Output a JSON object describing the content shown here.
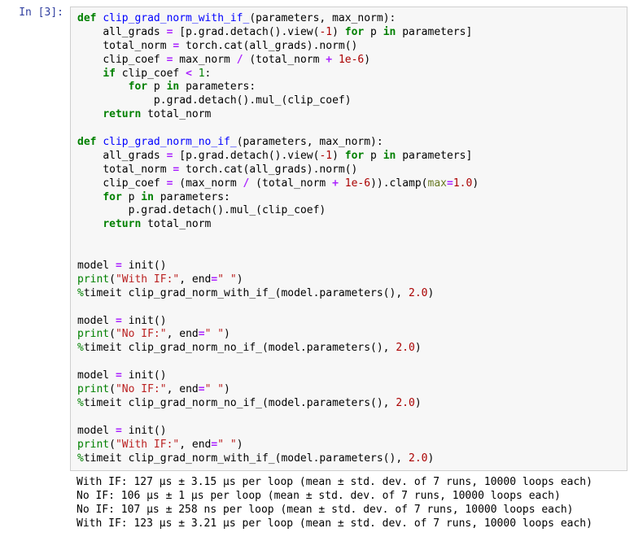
{
  "prompt": "In [3]:",
  "code": {
    "l1": {
      "def": "def",
      "fname": "clip_grad_norm_with_if_",
      "sig": "(parameters, max_norm):"
    },
    "l2": {
      "indent": "    ",
      "lhs": "all_grads ",
      "eq": "=",
      "mid": " [p.grad.detach().view(",
      "neg1": "-1",
      "after1": ") ",
      "for": "for",
      "mid2": " p ",
      "in": "in",
      "tail": " parameters]"
    },
    "l3": {
      "indent": "    ",
      "lhs": "total_norm ",
      "eq": "=",
      "tail": " torch.cat(all_grads).norm()"
    },
    "l4": {
      "indent": "    ",
      "lhs": "clip_coef ",
      "eq": "=",
      "mid": " max_norm ",
      "div": "/",
      "mid2": " (total_norm ",
      "plus": "+",
      "sp": " ",
      "eps": "1e-6",
      "close": ")"
    },
    "l5": {
      "indent": "    ",
      "if": "if",
      "mid": " clip_coef ",
      "lt": "<",
      "sp": " ",
      "one": "1",
      "colon": ":"
    },
    "l6": {
      "indent": "        ",
      "for": "for",
      "mid": " p ",
      "in": "in",
      "tail": " parameters:"
    },
    "l7": {
      "indent": "            ",
      "body": "p.grad.detach().mul_(clip_coef)"
    },
    "l8": {
      "indent": "    ",
      "ret": "return",
      "tail": " total_norm"
    },
    "l10": {
      "def": "def",
      "fname": "clip_grad_norm_no_if_",
      "sig": "(parameters, max_norm):"
    },
    "l11": {
      "indent": "    ",
      "lhs": "all_grads ",
      "eq": "=",
      "mid": " [p.grad.detach().view(",
      "neg1": "-1",
      "after1": ") ",
      "for": "for",
      "mid2": " p ",
      "in": "in",
      "tail": " parameters]"
    },
    "l12": {
      "indent": "    ",
      "lhs": "total_norm ",
      "eq": "=",
      "tail": " torch.cat(all_grads).norm()"
    },
    "l13": {
      "indent": "    ",
      "lhs": "clip_coef ",
      "eq": "=",
      "mid": " (max_norm ",
      "div": "/",
      "mid2": " (total_norm ",
      "plus": "+",
      "sp": " ",
      "eps": "1e-6",
      "after": ")).clamp(",
      "maxkw": "max",
      "eq2": "=",
      "one": "1.0",
      "close": ")"
    },
    "l14": {
      "indent": "    ",
      "for": "for",
      "mid": " p ",
      "in": "in",
      "tail": " parameters:"
    },
    "l15": {
      "indent": "        ",
      "body": "p.grad.detach().mul_(clip_coef)"
    },
    "l16": {
      "indent": "    ",
      "ret": "return",
      "tail": " total_norm"
    },
    "b1": {
      "model": "model ",
      "eq": "=",
      "tail": " init()"
    },
    "b2": {
      "print": "print",
      "open": "(",
      "str": "\"With IF:\"",
      "comma": ", end",
      "eq": "=",
      "str2": "\" \"",
      "close": ")"
    },
    "b3": {
      "pct": "%",
      "body": "timeit clip_grad_norm_with_if_(model.parameters(), ",
      "val": "2.0",
      "close": ")"
    },
    "b4": {
      "model": "model ",
      "eq": "=",
      "tail": " init()"
    },
    "b5": {
      "print": "print",
      "open": "(",
      "str": "\"No IF:\"",
      "comma": ", end",
      "eq": "=",
      "str2": "\" \"",
      "close": ")"
    },
    "b6": {
      "pct": "%",
      "body": "timeit clip_grad_norm_no_if_(model.parameters(), ",
      "val": "2.0",
      "close": ")"
    },
    "b7": {
      "model": "model ",
      "eq": "=",
      "tail": " init()"
    },
    "b8": {
      "print": "print",
      "open": "(",
      "str": "\"No IF:\"",
      "comma": ", end",
      "eq": "=",
      "str2": "\" \"",
      "close": ")"
    },
    "b9": {
      "pct": "%",
      "body": "timeit clip_grad_norm_no_if_(model.parameters(), ",
      "val": "2.0",
      "close": ")"
    },
    "b10": {
      "model": "model ",
      "eq": "=",
      "tail": " init()"
    },
    "b11": {
      "print": "print",
      "open": "(",
      "str": "\"With IF:\"",
      "comma": ", end",
      "eq": "=",
      "str2": "\" \"",
      "close": ")"
    },
    "b12": {
      "pct": "%",
      "body": "timeit clip_grad_norm_with_if_(model.parameters(), ",
      "val": "2.0",
      "close": ")"
    }
  },
  "output": {
    "l1": "With IF: 127 µs ± 3.15 µs per loop (mean ± std. dev. of 7 runs, 10000 loops each)",
    "l2": "No IF: 106 µs ± 1 µs per loop (mean ± std. dev. of 7 runs, 10000 loops each)",
    "l3": "No IF: 107 µs ± 258 ns per loop (mean ± std. dev. of 7 runs, 10000 loops each)",
    "l4": "With IF: 123 µs ± 3.21 µs per loop (mean ± std. dev. of 7 runs, 10000 loops each)"
  }
}
